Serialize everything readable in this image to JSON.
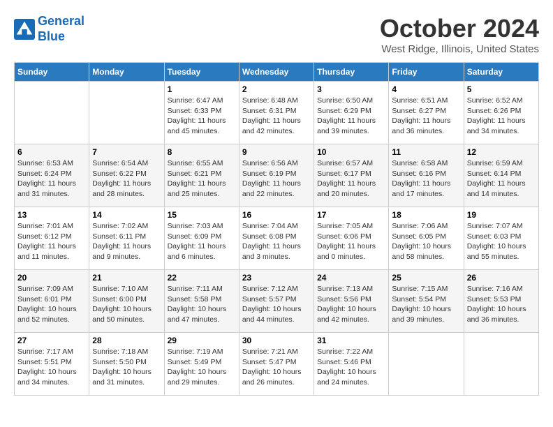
{
  "header": {
    "logo_line1": "General",
    "logo_line2": "Blue",
    "month_title": "October 2024",
    "location": "West Ridge, Illinois, United States"
  },
  "weekdays": [
    "Sunday",
    "Monday",
    "Tuesday",
    "Wednesday",
    "Thursday",
    "Friday",
    "Saturday"
  ],
  "weeks": [
    [
      {
        "day": "",
        "info": ""
      },
      {
        "day": "",
        "info": ""
      },
      {
        "day": "1",
        "info": "Sunrise: 6:47 AM\nSunset: 6:33 PM\nDaylight: 11 hours and 45 minutes."
      },
      {
        "day": "2",
        "info": "Sunrise: 6:48 AM\nSunset: 6:31 PM\nDaylight: 11 hours and 42 minutes."
      },
      {
        "day": "3",
        "info": "Sunrise: 6:50 AM\nSunset: 6:29 PM\nDaylight: 11 hours and 39 minutes."
      },
      {
        "day": "4",
        "info": "Sunrise: 6:51 AM\nSunset: 6:27 PM\nDaylight: 11 hours and 36 minutes."
      },
      {
        "day": "5",
        "info": "Sunrise: 6:52 AM\nSunset: 6:26 PM\nDaylight: 11 hours and 34 minutes."
      }
    ],
    [
      {
        "day": "6",
        "info": "Sunrise: 6:53 AM\nSunset: 6:24 PM\nDaylight: 11 hours and 31 minutes."
      },
      {
        "day": "7",
        "info": "Sunrise: 6:54 AM\nSunset: 6:22 PM\nDaylight: 11 hours and 28 minutes."
      },
      {
        "day": "8",
        "info": "Sunrise: 6:55 AM\nSunset: 6:21 PM\nDaylight: 11 hours and 25 minutes."
      },
      {
        "day": "9",
        "info": "Sunrise: 6:56 AM\nSunset: 6:19 PM\nDaylight: 11 hours and 22 minutes."
      },
      {
        "day": "10",
        "info": "Sunrise: 6:57 AM\nSunset: 6:17 PM\nDaylight: 11 hours and 20 minutes."
      },
      {
        "day": "11",
        "info": "Sunrise: 6:58 AM\nSunset: 6:16 PM\nDaylight: 11 hours and 17 minutes."
      },
      {
        "day": "12",
        "info": "Sunrise: 6:59 AM\nSunset: 6:14 PM\nDaylight: 11 hours and 14 minutes."
      }
    ],
    [
      {
        "day": "13",
        "info": "Sunrise: 7:01 AM\nSunset: 6:12 PM\nDaylight: 11 hours and 11 minutes."
      },
      {
        "day": "14",
        "info": "Sunrise: 7:02 AM\nSunset: 6:11 PM\nDaylight: 11 hours and 9 minutes."
      },
      {
        "day": "15",
        "info": "Sunrise: 7:03 AM\nSunset: 6:09 PM\nDaylight: 11 hours and 6 minutes."
      },
      {
        "day": "16",
        "info": "Sunrise: 7:04 AM\nSunset: 6:08 PM\nDaylight: 11 hours and 3 minutes."
      },
      {
        "day": "17",
        "info": "Sunrise: 7:05 AM\nSunset: 6:06 PM\nDaylight: 11 hours and 0 minutes."
      },
      {
        "day": "18",
        "info": "Sunrise: 7:06 AM\nSunset: 6:05 PM\nDaylight: 10 hours and 58 minutes."
      },
      {
        "day": "19",
        "info": "Sunrise: 7:07 AM\nSunset: 6:03 PM\nDaylight: 10 hours and 55 minutes."
      }
    ],
    [
      {
        "day": "20",
        "info": "Sunrise: 7:09 AM\nSunset: 6:01 PM\nDaylight: 10 hours and 52 minutes."
      },
      {
        "day": "21",
        "info": "Sunrise: 7:10 AM\nSunset: 6:00 PM\nDaylight: 10 hours and 50 minutes."
      },
      {
        "day": "22",
        "info": "Sunrise: 7:11 AM\nSunset: 5:58 PM\nDaylight: 10 hours and 47 minutes."
      },
      {
        "day": "23",
        "info": "Sunrise: 7:12 AM\nSunset: 5:57 PM\nDaylight: 10 hours and 44 minutes."
      },
      {
        "day": "24",
        "info": "Sunrise: 7:13 AM\nSunset: 5:56 PM\nDaylight: 10 hours and 42 minutes."
      },
      {
        "day": "25",
        "info": "Sunrise: 7:15 AM\nSunset: 5:54 PM\nDaylight: 10 hours and 39 minutes."
      },
      {
        "day": "26",
        "info": "Sunrise: 7:16 AM\nSunset: 5:53 PM\nDaylight: 10 hours and 36 minutes."
      }
    ],
    [
      {
        "day": "27",
        "info": "Sunrise: 7:17 AM\nSunset: 5:51 PM\nDaylight: 10 hours and 34 minutes."
      },
      {
        "day": "28",
        "info": "Sunrise: 7:18 AM\nSunset: 5:50 PM\nDaylight: 10 hours and 31 minutes."
      },
      {
        "day": "29",
        "info": "Sunrise: 7:19 AM\nSunset: 5:49 PM\nDaylight: 10 hours and 29 minutes."
      },
      {
        "day": "30",
        "info": "Sunrise: 7:21 AM\nSunset: 5:47 PM\nDaylight: 10 hours and 26 minutes."
      },
      {
        "day": "31",
        "info": "Sunrise: 7:22 AM\nSunset: 5:46 PM\nDaylight: 10 hours and 24 minutes."
      },
      {
        "day": "",
        "info": ""
      },
      {
        "day": "",
        "info": ""
      }
    ]
  ]
}
